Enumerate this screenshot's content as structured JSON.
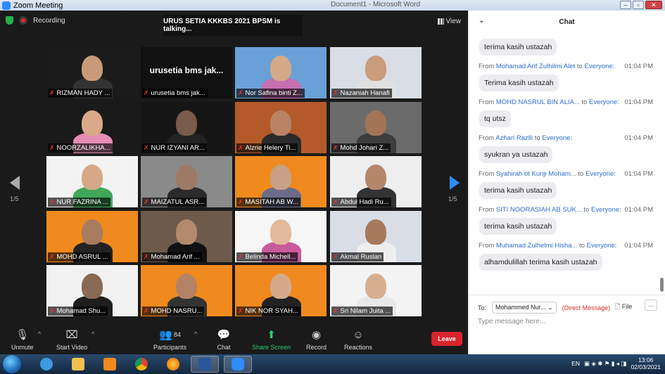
{
  "window": {
    "title": "Zoom Meeting",
    "background_title": "Document1 - Microsoft Word"
  },
  "meeting": {
    "recording_label": "Recording",
    "talking_banner": "URUS SETIA KKKBS 2021 BPSM is talking...",
    "view_label": "View"
  },
  "pager": {
    "left": "1/5",
    "right": "1/5"
  },
  "participants": [
    {
      "name": "RIZMAN HADY ...",
      "bg": "#1b1b1b",
      "skin": "#c89a7a",
      "shirt": "#333"
    },
    {
      "name": "urusetia bms jak...",
      "bg": "#111111",
      "text_only": true
    },
    {
      "name": "Nor Safina binti Z...",
      "bg": "#6aa0d8",
      "skin": "#d4a987",
      "shirt": "#c86fb0"
    },
    {
      "name": "Nazaniah Hanafi",
      "bg": "#d9dde6",
      "skin": "#c99c7d",
      "shirt": "#e0e0e0"
    },
    {
      "name": "NOORZALIKHA...",
      "bg": "#1a1a1a",
      "skin": "#d9a98a",
      "shirt": "#e58db4"
    },
    {
      "name": "NUR IZYANI AR...",
      "bg": "#151515",
      "skin": "#7a5a48",
      "shirt": "#222"
    },
    {
      "name": "Alzrie Helery Ti...",
      "bg": "#b45a2a",
      "skin": "#b88466",
      "shirt": "#2a2a2a"
    },
    {
      "name": "Mohd Johari Z...",
      "bg": "#6b6b6b",
      "skin": "#a27556",
      "shirt": "#3d3d3d"
    },
    {
      "name": "NUR FAZRINA ...",
      "bg": "#f3f3f3",
      "skin": "#d7a887",
      "shirt": "#3fa85a"
    },
    {
      "name": "MAIZATUL ASR...",
      "bg": "#8a8a8a",
      "skin": "#9c7a66",
      "shirt": "#2b2b2b"
    },
    {
      "name": "MASITAH AB W...",
      "bg": "#f08a1e",
      "skin": "#c9a088",
      "shirt": "#6c6c8a"
    },
    {
      "name": "Abdul Hadi Ru...",
      "bg": "#eeeeee",
      "skin": "#b5876a",
      "shirt": "#333"
    },
    {
      "name": "MOHD ASRUL ...",
      "bg": "#f08a1e",
      "skin": "#a77c5e",
      "shirt": "#222"
    },
    {
      "name": "Mohamad Arif ...",
      "bg": "#6e5a4a",
      "skin": "#b38a6e",
      "shirt": "#111"
    },
    {
      "name": "Belinda Michell...",
      "bg": "#f6f6f6",
      "skin": "#e2b99a",
      "shirt": "#c75b9c"
    },
    {
      "name": "Akmal Ruslan",
      "bg": "#d9dde6",
      "skin": "#a67a5c",
      "shirt": "#eeeeee"
    },
    {
      "name": "Mohamad Shu...",
      "bg": "#f2f2f2",
      "skin": "#8a6a55",
      "shirt": "#1e1e1e"
    },
    {
      "name": "MOHD NASRU...",
      "bg": "#f08a1e",
      "skin": "#b48264",
      "shirt": "#333"
    },
    {
      "name": "NIK NOR SYAH...",
      "bg": "#f08a1e",
      "skin": "#d6a98a",
      "shirt": "#222"
    },
    {
      "name": "Sri Nilam Juita ...",
      "bg": "#f4f4f4",
      "skin": "#d8ae90",
      "shirt": "#e8e8e8"
    }
  ],
  "toolbar": {
    "unmute": "Unmute",
    "start_video": "Start Video",
    "participants": "Participants",
    "participants_count": "84",
    "chat": "Chat",
    "share": "Share Screen",
    "record": "Record",
    "reactions": "Reactions",
    "leave": "Leave"
  },
  "chat": {
    "title": "Chat",
    "messages": [
      {
        "from": "",
        "to": "",
        "time": "",
        "text": "terima kasih ustazah"
      },
      {
        "from": "Mohamad Arif Zulhilmi Alet",
        "to": "Everyone:",
        "time": "01:04 PM",
        "text": "Terima kasih ustazah"
      },
      {
        "from": "MOHD NASRUL BIN ALIA...",
        "to": "Everyone:",
        "time": "01:04 PM",
        "text": "tq utsz"
      },
      {
        "from": "Azhari Razlli",
        "to": "Everyone:",
        "time": "01:04 PM",
        "text": "syukran ya ustazah"
      },
      {
        "from": "Syahirah bt Kunji Moham...",
        "to": "Everyone:",
        "time": "01:04 PM",
        "text": "terima kasih ustazah"
      },
      {
        "from": "SITI NOORASIAH AB SUK...",
        "to": "Everyone:",
        "time": "01:04 PM",
        "text": "terima kasih ustazah"
      },
      {
        "from": "Muhamad Zulhelmi Hisha...",
        "to": "Everyone:",
        "time": "01:04 PM",
        "text": "alhamdulillah terima kasih ustazah"
      }
    ],
    "from_word": "From",
    "to_word": "to",
    "to_label": "To:",
    "recipient": "Mohammed Nur...",
    "direct_message": "(Direct Message)",
    "file_label": "File",
    "more_label": "...",
    "input_placeholder": "Type message here..."
  },
  "taskbar": {
    "lang": "EN",
    "time": "13:06",
    "date": "02/03/2021"
  }
}
